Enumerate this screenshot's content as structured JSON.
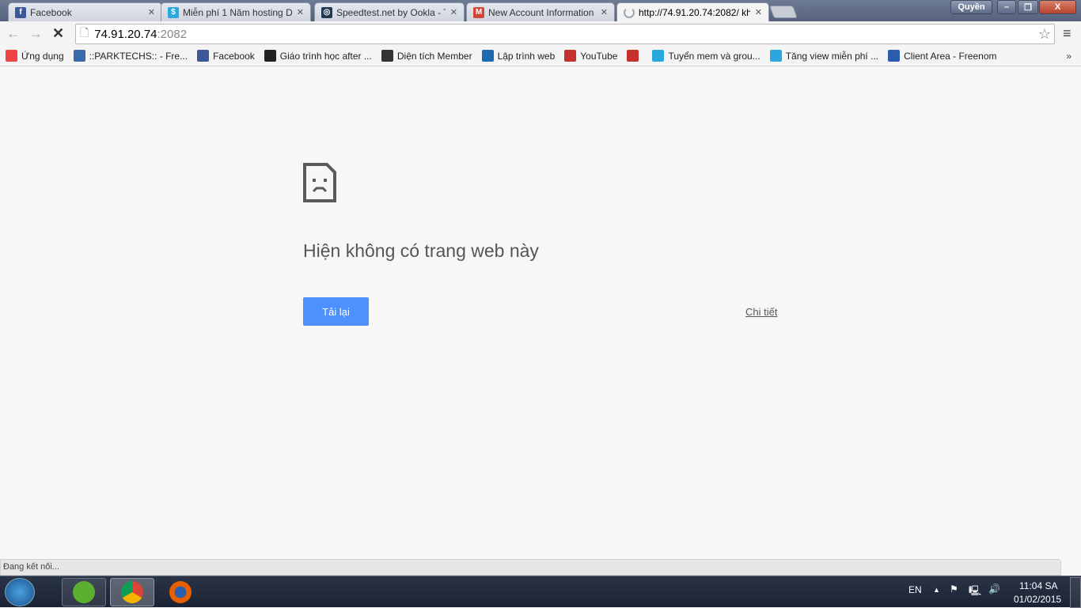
{
  "tabs": [
    {
      "title": "Facebook",
      "icon": "facebook-icon",
      "color": "#3b5998",
      "glyph": "f"
    },
    {
      "title": "Miễn phí 1 Năm hosting D",
      "icon": "dollar-icon",
      "color": "#29a8e0",
      "glyph": "$"
    },
    {
      "title": "Speedtest.net by Ookla - T",
      "icon": "speedtest-icon",
      "color": "#1e3a50",
      "glyph": "◎"
    },
    {
      "title": "New Account Information",
      "icon": "gmail-icon",
      "color": "#d44638",
      "glyph": "M"
    },
    {
      "title": "http://74.91.20.74:2082/ kh",
      "icon": "loading-icon",
      "color": "#9ab",
      "glyph": ""
    }
  ],
  "window": {
    "user": "Quyền",
    "close": "X"
  },
  "address": {
    "host": "74.91.20.74",
    "port": ":2082"
  },
  "bookmarks": [
    {
      "label": "Ứng dụng",
      "icon": "apps-icon",
      "color": "#e44"
    },
    {
      "label": "::PARKTECHS:: - Fre...",
      "icon": "globe-icon",
      "color": "#3a6aa8"
    },
    {
      "label": "Facebook",
      "icon": "facebook-icon",
      "color": "#3b5998"
    },
    {
      "label": "Giáo trình học after ...",
      "icon": "tie-icon",
      "color": "#222"
    },
    {
      "label": "Diện tích Member",
      "icon": "sail-icon",
      "color": "#333"
    },
    {
      "label": "Lập trình web",
      "icon": "bookmark-icon",
      "color": "#1e6ab0"
    },
    {
      "label": "YouTube",
      "icon": "youtube-icon",
      "color": "#c4302b"
    },
    {
      "label": "",
      "icon": "youtube-icon",
      "color": "#c4302b"
    },
    {
      "label": "Tuyển mem và grou...",
      "icon": "dollar-icon",
      "color": "#29a8e0"
    },
    {
      "label": "Tăng view miễn phí ...",
      "icon": "dollar-icon",
      "color": "#29a8e0"
    },
    {
      "label": "Client Area - Freenom",
      "icon": "freenom-icon",
      "color": "#2a5db0"
    }
  ],
  "error": {
    "title": "Hiện không có trang web này",
    "reload": "Tải lại",
    "details": "Chi tiết",
    "accent": "#4d90fe"
  },
  "status": "Đang kết nối...",
  "tray": {
    "lang": "EN",
    "time": "11:04 SA",
    "date": "01/02/2015"
  }
}
